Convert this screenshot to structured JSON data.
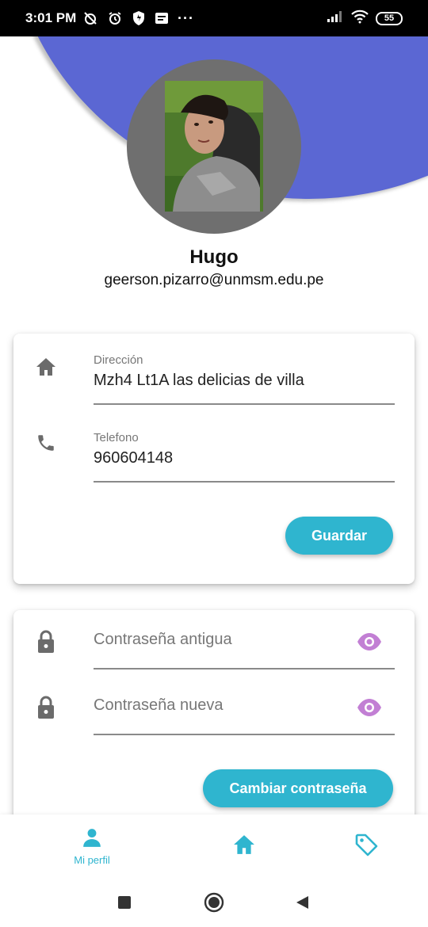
{
  "status_bar": {
    "time": "3:01 PM",
    "battery": "55",
    "more": "···",
    "icons": [
      "alarm-off-icon",
      "alarm-icon",
      "shield-icon",
      "message-icon",
      "signal-icon",
      "wifi-icon",
      "battery-icon"
    ]
  },
  "profile": {
    "name": "Hugo",
    "email": "geerson.pizarro@unmsm.edu.pe"
  },
  "info_card": {
    "address_label": "Dirección",
    "address_value": "Mzh4 Lt1A las delicias de villa",
    "phone_label": "Telefono",
    "phone_value": "960604148",
    "save_button": "Guardar"
  },
  "password_card": {
    "old_password_placeholder": "Contraseña antigua",
    "new_password_placeholder": "Contraseña nueva",
    "change_button": "Cambiar contraseña"
  },
  "bottom_nav": {
    "profile_label": "Mi perfil",
    "items": [
      "person-icon",
      "home-icon",
      "tag-icon"
    ]
  },
  "colors": {
    "header_blob": "#5b67d3",
    "accent": "#2fb5cf",
    "eye_icon": "#c27fd4",
    "avatar_ring": "#6f6f6f"
  }
}
